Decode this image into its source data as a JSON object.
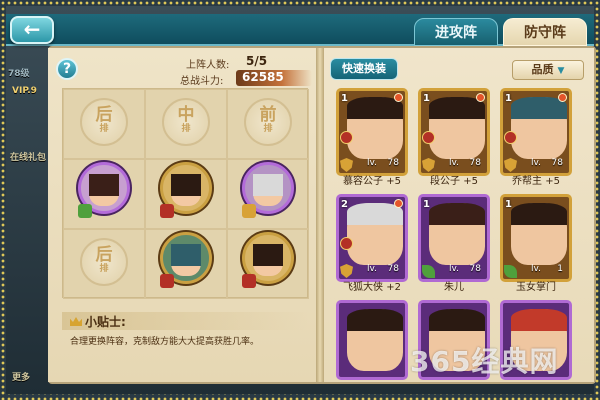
{
  "header": {
    "back_icon": "back-arrow-icon",
    "tabs": [
      {
        "label": "进攻阵",
        "active": false
      },
      {
        "label": "防守阵",
        "active": true
      }
    ]
  },
  "background": {
    "level_text": "78级",
    "vip_text": "VIP.9",
    "online_text": "在线礼包",
    "more_text": "更多"
  },
  "formation": {
    "help_label": "?",
    "count_label": "上阵人数:",
    "count_value": "5/5",
    "power_label": "总战斗力:",
    "power_value": "62585",
    "empty_slots": [
      {
        "big": "后",
        "small": "排"
      },
      {
        "big": "中",
        "small": "排"
      },
      {
        "big": "前",
        "small": "排"
      },
      {
        "big": "后",
        "small": "排"
      }
    ],
    "tips_title": "小贴士:",
    "tips_text": "合理更换阵容，克制敌方能大大提高获胜几率。"
  },
  "roster": {
    "quick_swap_label": "快速换装",
    "quality_label": "品质",
    "cards": [
      {
        "name": "慕容公子 +5",
        "level": "78",
        "star": "1",
        "quality": "gold"
      },
      {
        "name": "段公子 +5",
        "level": "78",
        "star": "1",
        "quality": "gold"
      },
      {
        "name": "乔帮主 +5",
        "level": "78",
        "star": "1",
        "quality": "gold"
      },
      {
        "name": "飞狐大侠 +2",
        "level": "78",
        "star": "2",
        "quality": "purple"
      },
      {
        "name": "朱儿",
        "level": "78",
        "star": "1",
        "quality": "purple"
      },
      {
        "name": "玉女掌门",
        "level": "1",
        "star": "1",
        "quality": "gold"
      },
      {
        "name": "",
        "level": "",
        "star": "",
        "quality": "purple"
      },
      {
        "name": "",
        "level": "",
        "star": "",
        "quality": "purple"
      },
      {
        "name": "",
        "level": "",
        "star": "",
        "quality": "purple"
      }
    ],
    "lv_prefix": "lv."
  },
  "watermark": "365经典网",
  "colors": {
    "teal": "#1e6a7c",
    "gold_border": "#d2a13a",
    "purple_border": "#b06ad3",
    "power_text": "#ffffff"
  }
}
